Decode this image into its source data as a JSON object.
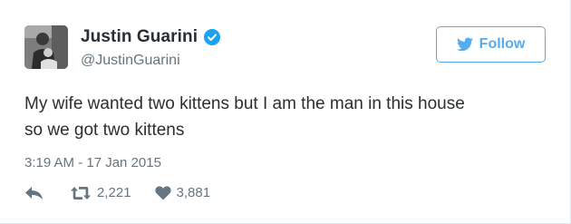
{
  "user": {
    "name": "Justin Guarini",
    "handle": "@JustinGuarini",
    "verified": true
  },
  "follow_button": {
    "label": "Follow",
    "icon": "twitter-bird-icon",
    "color": "#55acee"
  },
  "tweet": {
    "text_line1": "My wife wanted two kittens but I am the man in this house",
    "text_line2": "so we got two kittens",
    "timestamp": "3:19 AM - 17 Jan 2015"
  },
  "actions": {
    "reply_icon": "reply-icon",
    "retweet_icon": "retweet-icon",
    "retweet_count": "2,221",
    "like_icon": "heart-icon",
    "like_count": "3,881"
  },
  "colors": {
    "text": "#292f33",
    "secondary": "#66757f",
    "verified": "#1da1f2"
  }
}
